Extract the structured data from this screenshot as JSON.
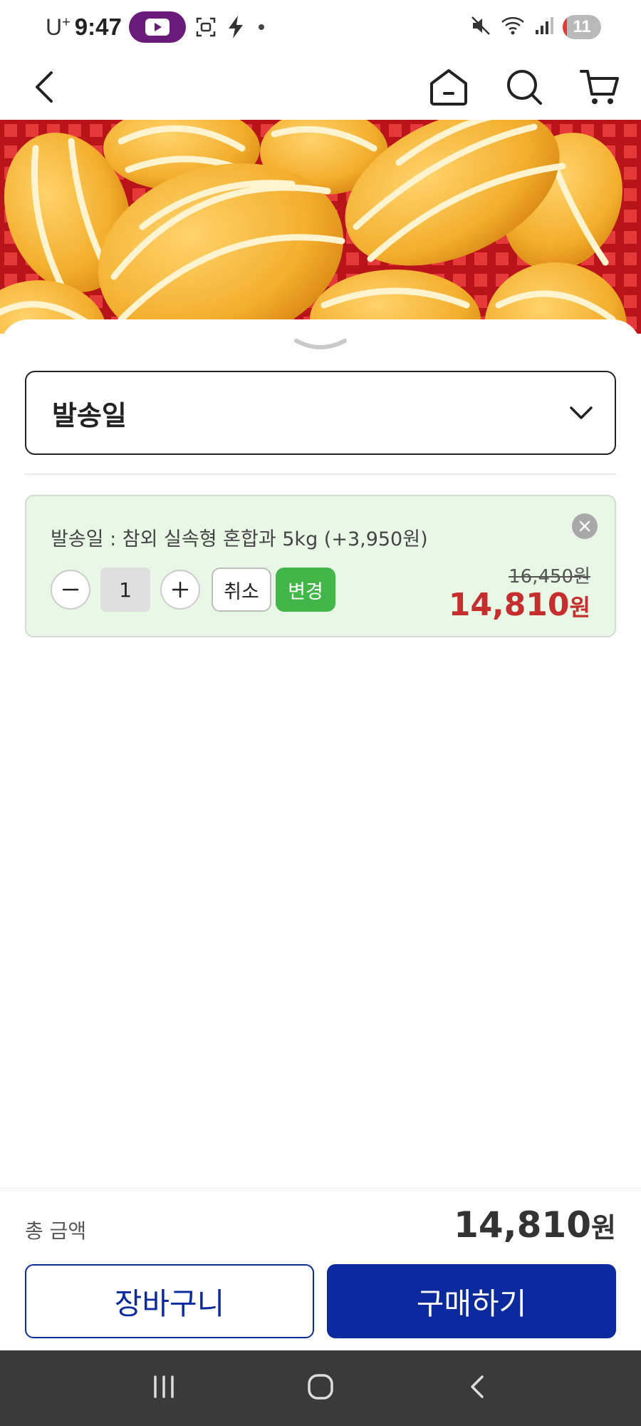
{
  "status_bar": {
    "carrier": "U",
    "carrier_sup": "+",
    "time": "9:47",
    "battery": "11"
  },
  "top_nav": {
    "icons": [
      "back-arrow-icon",
      "home-icon",
      "search-icon",
      "cart-icon"
    ]
  },
  "option_select": {
    "label": "발송일"
  },
  "selected_option": {
    "title": "발송일 : 참외 실속형 혼합과 5kg (+3,950원)",
    "quantity": "1",
    "cancel_label": "취소",
    "change_label": "변경",
    "original_price": "16,450원",
    "sale_price": "14,810",
    "sale_price_unit": "원"
  },
  "summary": {
    "total_label": "총 금액",
    "total_amount": "14,810",
    "total_unit": "원"
  },
  "actions": {
    "cart_label": "장바구니",
    "buy_label": "구매하기"
  },
  "colors": {
    "primary": "#0a2a9e",
    "sale_red": "#c62d2d",
    "change_green": "#43b649",
    "option_bg": "#e9f8e6"
  }
}
